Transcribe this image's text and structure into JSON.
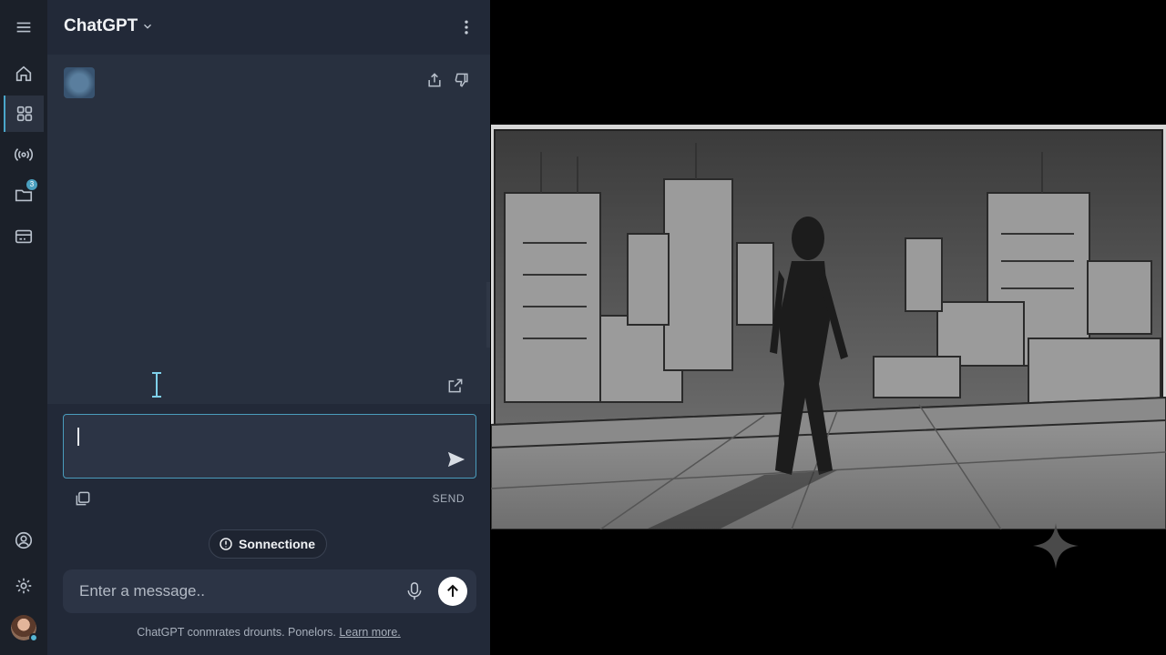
{
  "header": {
    "title": "ChatGPT"
  },
  "compose": {
    "send_label": "SEND"
  },
  "status": {
    "connection_label": "Sonnectione"
  },
  "message_bar": {
    "placeholder": "Enter a message.."
  },
  "footer": {
    "disclaimer_text": "ChatGPT conmrates drounts. Ponelors. ",
    "learn_more": "Learn more."
  },
  "icons": {
    "rail": [
      "menu-icon",
      "home-icon",
      "grid-icon",
      "broadcast-icon",
      "folder-icon",
      "card-icon",
      "account-icon",
      "settings-icon"
    ],
    "folder_badge": "3"
  },
  "colors": {
    "accent": "#4a9cbc",
    "panel_bg": "#222938",
    "rail_bg": "#1b2029",
    "stage_bg": "#000000"
  }
}
